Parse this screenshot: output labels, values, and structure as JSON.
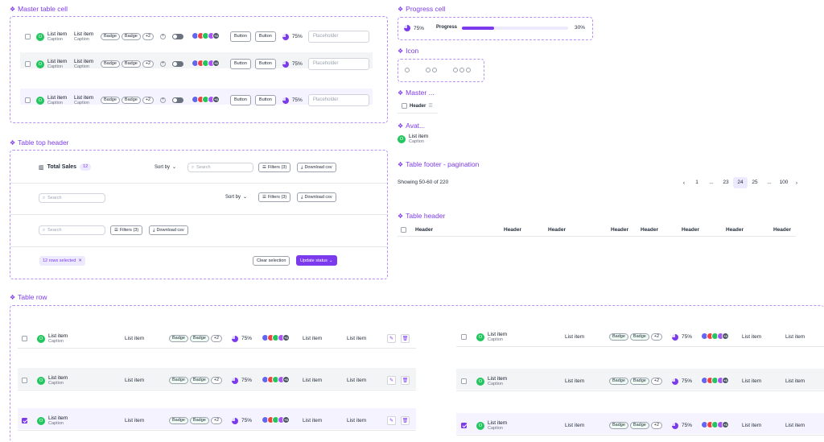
{
  "sections": {
    "master_cell": "Master table cell",
    "top_header": "Table top header",
    "table_row": "Table row",
    "progress_cell": "Progress cell",
    "icon": "Icon",
    "master_short": "Master ...",
    "avatar_short": "Avat...",
    "footer": "Table footer - pagination",
    "table_header": "Table header"
  },
  "cell": {
    "avatar": "O",
    "title": "List item",
    "caption": "Caption",
    "badge": "Badge",
    "more": "+2",
    "group_more": "+3",
    "button": "Button",
    "percent": "75%",
    "placeholder": "Placeholder"
  },
  "progress": {
    "percent": "75%",
    "label": "Progress",
    "value_text": "30%",
    "value": 0.3
  },
  "master_header": {
    "label": "Header"
  },
  "top_header": {
    "title": "Total Sales",
    "count": "12",
    "sort": "Sort by",
    "search": "Search",
    "filters": "Filters (3)",
    "download": "Download csv",
    "selected": "12 rows selected",
    "clear": "Clear selection",
    "update": "Update status"
  },
  "pagination": {
    "showing": "Showing 50-60 of 220",
    "pages": [
      "1",
      "...",
      "23",
      "24",
      "25",
      "...",
      "100"
    ],
    "current": "24"
  },
  "table_header": {
    "cols": [
      "Header",
      "Header",
      "Header",
      "Header",
      "Header",
      "Header",
      "Header",
      "Header"
    ]
  },
  "colors": {
    "accent": "#7c3aed",
    "avatar_green": "#22c55e",
    "group": [
      "#6366f1",
      "#ef4444",
      "#22c55e",
      "#a855f7",
      "#4b5563"
    ]
  }
}
